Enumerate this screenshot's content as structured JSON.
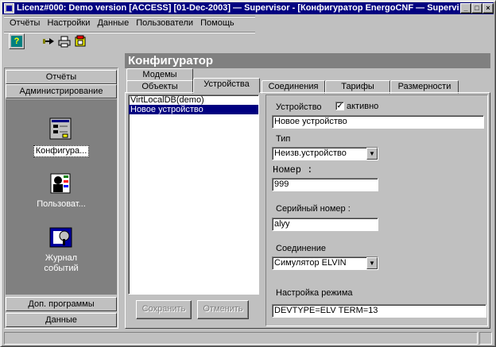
{
  "window": {
    "title": "Licenz#000: Demo version [ACCESS] [01-Dec-2003] — Supervisor - [Конфигуратор EnergoCNF — Supervis..."
  },
  "menu": [
    "Отчёты",
    "Настройки",
    "Данные",
    "Пользователи",
    "Помощь"
  ],
  "toolbar": {
    "help_icon": "help-icon",
    "tools": [
      "arrow-icon",
      "printer-icon",
      "config-icon"
    ]
  },
  "header": {
    "title": "Конфигуратор"
  },
  "sidebar": {
    "top_buttons": [
      "Отчёты",
      "Администрирование"
    ],
    "items": [
      {
        "label": "Конфигура...",
        "icon": "configurator-icon",
        "selected": true
      },
      {
        "label": "Пользоват...",
        "icon": "users-icon",
        "selected": false
      },
      {
        "label_lines": [
          "Журнал",
          "событий"
        ],
        "icon": "event-log-icon",
        "selected": false
      }
    ],
    "bottom_buttons": [
      "Доп. программы",
      "Данные"
    ]
  },
  "tabs": {
    "row1": [
      "Модемы"
    ],
    "row2": [
      "Объекты",
      "Устройства",
      "Соединения",
      "Тарифы",
      "Размерности"
    ],
    "active": "Устройства"
  },
  "device_list": {
    "items": [
      "VirtLocalDB(demo)",
      "Новое устройство"
    ],
    "selected_index": 1
  },
  "buttons": {
    "save": "Сохранить",
    "cancel": "Отменить"
  },
  "form": {
    "device_label": "Устройство",
    "active_label": "активно",
    "active_checked": true,
    "device_value": "Новое устройство",
    "type_label": "Тип",
    "type_value": "Неизв.устройство",
    "number_label": "Номер :",
    "number_value": "999",
    "serial_label": "Серийный номер :",
    "serial_value": "alyy",
    "connection_label": "Соединение",
    "connection_value": "Симулятор ELVIN",
    "mode_label": "Настройка режима",
    "mode_value": "DEVTYPE=ELV   TERM=13"
  }
}
